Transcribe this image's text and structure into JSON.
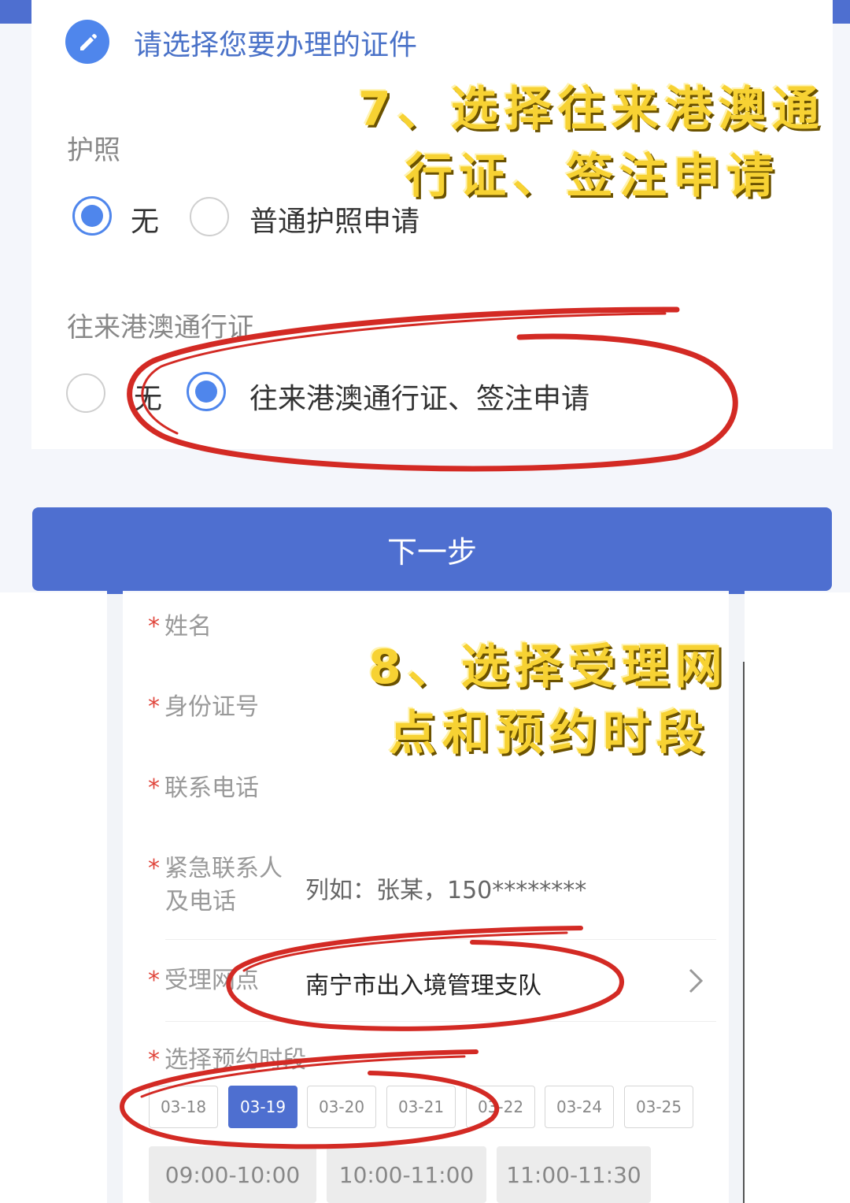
{
  "form_top": {
    "title": "请选择您要办理的证件",
    "passport": {
      "label": "护照",
      "options": [
        "无",
        "普通护照申请"
      ],
      "selected": "无"
    },
    "hk_macau": {
      "label": "往来港澳通行证",
      "options": [
        "无",
        "往来港澳通行证、签注申请"
      ],
      "selected": "往来港澳通行证、签注申请"
    },
    "next_button": "下一步"
  },
  "captions": {
    "step7_line1": "7、选择往来港澳通",
    "step7_line2": "行证、签注申请",
    "step8_line1": "8、选择受理网",
    "step8_line2": "点和预约时段"
  },
  "form_bottom": {
    "required_mark": "*",
    "name_label": "姓名",
    "id_label": "身份证号",
    "phone_label": "联系电话",
    "emergency_label_1": "紧急联系人",
    "emergency_label_2": "及电话",
    "emergency_placeholder": "列如：张某，150********",
    "office_label": "受理网点",
    "office_value": "南宁市出入境管理支队",
    "slot_label": "选择预约时段",
    "dates": [
      "03-18",
      "03-19",
      "03-20",
      "03-21",
      "03-22",
      "03-24",
      "03-25"
    ],
    "selected_date": "03-19",
    "times": [
      "09:00-10:00",
      "10:00-11:00",
      "11:00-11:30"
    ]
  },
  "colors": {
    "primary": "#4e6fd0",
    "radio_blue": "#4f86ec",
    "caption_yellow": "#f7d233",
    "annotation_red": "#d32a24",
    "required_red": "#e0463c"
  }
}
